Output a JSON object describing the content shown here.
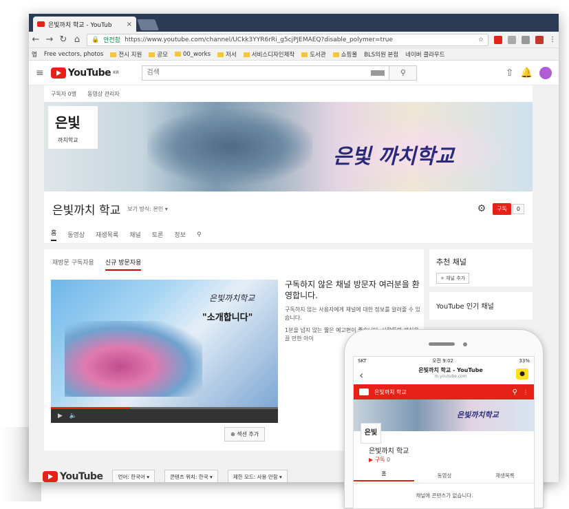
{
  "browser": {
    "tab_title": "은빛까치 학교 - YouTub",
    "tab_close": "×",
    "secure_label": "안전함",
    "url": "https://www.youtube.com/channel/UCkk3YYR6rRi_g5cjPJEMAEQ?disable_polymer=true",
    "bookmarks": [
      "앱",
      "Free vectors, photos",
      "전시 지원",
      "공모",
      "00_works",
      "저서",
      "서비스디자인제작",
      "도서관",
      "쇼핑몰",
      "BLS의원 본점",
      "네이버 클라우드"
    ]
  },
  "youtube": {
    "logo": "YouTube",
    "region": "KR",
    "search_placeholder": "검색"
  },
  "channel": {
    "subscriber_bar": [
      "구독자 0명",
      "동영상 관리자"
    ],
    "banner_logo": "은빛",
    "banner_sub": "까치학교",
    "banner_title": "은빛 까치학교",
    "name": "은빛까치 학교",
    "view_as": "보기 방식: 본인 ▾",
    "subscribe": "구독",
    "subscribe_count": "0",
    "tabs": [
      "홈",
      "동영상",
      "재생목록",
      "채널",
      "토론",
      "정보"
    ],
    "subtabs": [
      "재방문 구독자용",
      "신규 방문자용"
    ],
    "video_logo": "은빛까치학교",
    "video_intro": "\"소개합니다\"",
    "video_title": "구독하지 않은 채널 방문자 여러분을 환영합니다.",
    "video_desc": "구독하지 않는 사용자에게 채널에 대한 정보를 알려줄 수 있습니다.",
    "video_desc2": "1분을 넘지 않는 짧은 예고편이 좋습니다. 사람들의 관심을 끌 만한 아이",
    "add_section": "섹션 추가",
    "side_recommended": "추천 채널",
    "side_add_channel": "+ 채널 추가",
    "side_popular": "YouTube 인기 채널"
  },
  "footer": {
    "logo": "YouTube",
    "language": "언어: 한국어 ▾",
    "content_location": "콘텐츠 위치: 한국 ▾",
    "restricted": "제한 모드: 사용 안함 ▾"
  },
  "phone": {
    "carrier": "SKT",
    "time": "오전 9:02",
    "battery": "33%",
    "page_title": "은빛까치 학교 - YouTube",
    "page_url": "m.youtube.com",
    "channel_bar": "은빛까치 학교",
    "banner_title": "은빛까치학교",
    "channel_name": "은빛까치 학교",
    "subscribe": "구독",
    "subscribe_count": "0",
    "tabs": [
      "홈",
      "동영상",
      "재생목록"
    ],
    "empty": "채널에 콘텐츠가 없습니다."
  },
  "colors": {
    "brand_red": "#e62117",
    "tab_strip": "#2b3a55"
  }
}
